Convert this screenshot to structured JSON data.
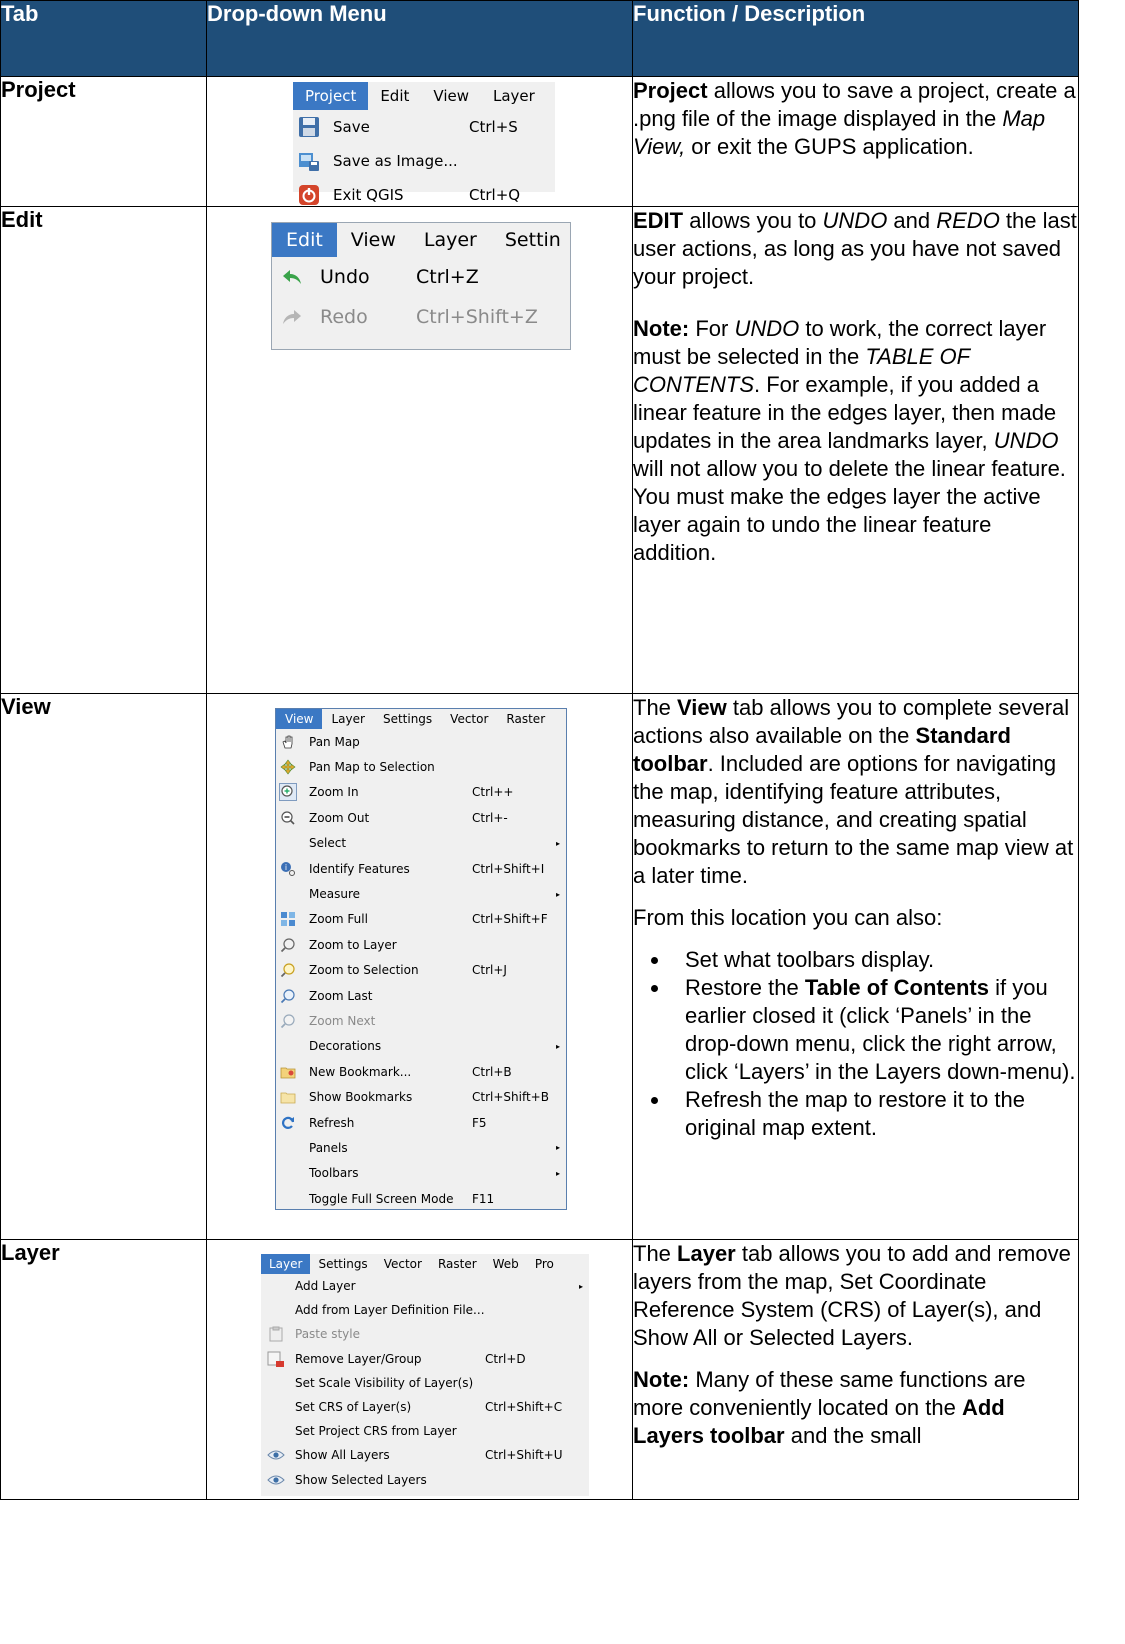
{
  "table": {
    "headers": [
      "Tab",
      "Drop-down Menu",
      "Function / Description"
    ]
  },
  "colors": {
    "header_bg": "#1f4e79",
    "menu_highlight": "#3b78c4"
  },
  "rows": {
    "project": {
      "tab": "Project",
      "menu": {
        "bar": [
          "Project",
          "Edit",
          "View",
          "Layer"
        ],
        "items": [
          {
            "icon": "save-icon",
            "label": "Save",
            "shortcut": "Ctrl+S"
          },
          {
            "icon": "save-image-icon",
            "label": "Save as Image...",
            "shortcut": ""
          },
          {
            "icon": "exit-icon",
            "label": "Exit QGIS",
            "shortcut": "Ctrl+Q"
          }
        ]
      },
      "desc": {
        "bold": "Project",
        "t1": " allows you to save a project, create a .png file of the image displayed in the ",
        "ital": "Map View,",
        "t2": " or exit the GUPS application."
      }
    },
    "edit": {
      "tab": "Edit",
      "menu": {
        "bar": [
          "Edit",
          "View",
          "Layer",
          "Settin"
        ],
        "items": [
          {
            "icon": "undo-icon",
            "label": "Undo",
            "shortcut": "Ctrl+Z"
          },
          {
            "icon": "redo-icon",
            "label": "Redo",
            "shortcut": "Ctrl+Shift+Z"
          }
        ]
      },
      "desc": {
        "p1_bold": "EDIT",
        "p1_a": " allows you to ",
        "p1_i1": "UNDO",
        "p1_b": " and ",
        "p1_i2": "REDO",
        "p1_c": " the last user actions, as long as you have not saved your project.",
        "note_label": "Note:",
        "n_a": "  For ",
        "n_i1": "UNDO",
        "n_b": " to work, the correct layer must be selected in the ",
        "n_i2": "TABLE OF CONTENTS",
        "n_c": ". For example, if you added a linear feature in the edges layer, then made updates in the area landmarks layer, ",
        "n_i3": "UNDO",
        "n_d": " will not allow you to delete the linear feature. You must make the edges layer the active layer again to undo the linear feature addition."
      }
    },
    "view": {
      "tab": "View",
      "menu": {
        "bar": [
          "View",
          "Layer",
          "Settings",
          "Vector",
          "Raster"
        ],
        "items": [
          {
            "icon": "pan-hand-icon",
            "label": "Pan Map",
            "shortcut": "",
            "sub": false
          },
          {
            "icon": "pan-selection-icon",
            "label": "Pan Map to Selection",
            "shortcut": "",
            "sub": false
          },
          {
            "icon": "zoom-in-icon",
            "label": "Zoom In",
            "shortcut": "Ctrl++",
            "sub": false
          },
          {
            "icon": "zoom-out-icon",
            "label": "Zoom Out",
            "shortcut": "Ctrl+-",
            "sub": false
          },
          {
            "icon": "",
            "label": "Select",
            "shortcut": "",
            "sub": true
          },
          {
            "icon": "identify-icon",
            "label": "Identify Features",
            "shortcut": "Ctrl+Shift+I",
            "sub": false
          },
          {
            "icon": "",
            "label": "Measure",
            "shortcut": "",
            "sub": true
          },
          {
            "icon": "zoom-full-icon",
            "label": "Zoom Full",
            "shortcut": "Ctrl+Shift+F",
            "sub": false
          },
          {
            "icon": "zoom-layer-icon",
            "label": "Zoom to Layer",
            "shortcut": "",
            "sub": false
          },
          {
            "icon": "zoom-selection-icon",
            "label": "Zoom to Selection",
            "shortcut": "Ctrl+J",
            "sub": false
          },
          {
            "icon": "zoom-last-icon",
            "label": "Zoom Last",
            "shortcut": "",
            "sub": false
          },
          {
            "icon": "zoom-next-icon",
            "label": "Zoom Next",
            "shortcut": "",
            "sub": false,
            "disabled": true
          },
          {
            "icon": "",
            "label": "Decorations",
            "shortcut": "",
            "sub": true
          },
          {
            "icon": "new-bookmark-icon",
            "label": "New Bookmark...",
            "shortcut": "Ctrl+B",
            "sub": false
          },
          {
            "icon": "show-bookmarks-icon",
            "label": "Show Bookmarks",
            "shortcut": "Ctrl+Shift+B",
            "sub": false
          },
          {
            "icon": "refresh-icon",
            "label": "Refresh",
            "shortcut": "F5",
            "sub": false
          },
          {
            "icon": "",
            "label": "Panels",
            "shortcut": "",
            "sub": true
          },
          {
            "icon": "",
            "label": "Toolbars",
            "shortcut": "",
            "sub": true
          },
          {
            "icon": "",
            "label": "Toggle Full Screen Mode",
            "shortcut": "F11",
            "sub": false
          }
        ]
      },
      "desc": {
        "a": "The ",
        "b1": "View",
        "c": " tab allows you to complete several actions also available on the ",
        "b2": "Standard toolbar",
        "d": ". Included are options for navigating the map, identifying feature attributes, measuring distance, and creating spatial bookmarks to return to the same map view at a later time.",
        "p2": "From this location you can also:",
        "li1": "Set what toolbars display.",
        "li2_a": "Restore the ",
        "li2_b": "Table of Contents",
        "li2_c": " if you earlier closed it (click ‘Panels’ in the drop-down menu, click the right arrow, click ‘Layers’ in the Layers down-menu).",
        "li3": "Refresh the map to restore it to the original map extent."
      }
    },
    "layer": {
      "tab": "Layer",
      "menu": {
        "bar": [
          "Layer",
          "Settings",
          "Vector",
          "Raster",
          "Web",
          "Pro"
        ],
        "items": [
          {
            "icon": "",
            "label": "Add Layer",
            "shortcut": "",
            "sub": true
          },
          {
            "icon": "",
            "label": "Add from Layer Definition File...",
            "shortcut": "",
            "sub": false
          },
          {
            "icon": "paste-style-icon",
            "label": "Paste style",
            "shortcut": "",
            "sub": false,
            "disabled": true
          },
          {
            "icon": "remove-layer-icon",
            "label": "Remove Layer/Group",
            "shortcut": "Ctrl+D",
            "sub": false
          },
          {
            "icon": "",
            "label": "Set Scale Visibility of Layer(s)",
            "shortcut": "",
            "sub": false
          },
          {
            "icon": "",
            "label": "Set CRS of Layer(s)",
            "shortcut": "Ctrl+Shift+C",
            "sub": false
          },
          {
            "icon": "",
            "label": "Set Project CRS from Layer",
            "shortcut": "",
            "sub": false
          },
          {
            "icon": "eye-icon",
            "label": "Show All Layers",
            "shortcut": "Ctrl+Shift+U",
            "sub": false
          },
          {
            "icon": "eye-icon",
            "label": "Show Selected Layers",
            "shortcut": "",
            "sub": false
          }
        ]
      },
      "desc": {
        "a": "The ",
        "b1": "Layer",
        "c": " tab allows you to add and remove layers from the map, Set Coordinate Reference System (CRS) of Layer(s), and Show All or Selected Layers.",
        "note_label": "Note:",
        "n_a": "  Many of these same functions are more conveniently located on the ",
        "n_b": "Add Layers toolbar",
        "n_c": " and the small"
      }
    }
  }
}
